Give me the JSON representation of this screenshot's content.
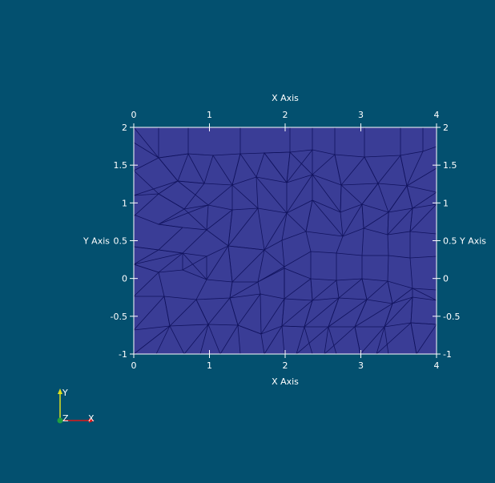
{
  "colors": {
    "background": "#03506f",
    "mesh_fill": "#3a3d96",
    "mesh_edge": "#11135e",
    "axis": "#ffffff",
    "text": "#ffffff",
    "triad_x": "#e01818",
    "triad_y": "#e0e020",
    "triad_z": "#20a040"
  },
  "axes": {
    "x_title_top": "X Axis",
    "x_title_bottom": "X Axis",
    "y_title_left": "Y Axis",
    "y_title_right": "Y Axis",
    "x_ticks": [
      "0",
      "1",
      "2",
      "3",
      "4"
    ],
    "y_ticks": [
      "2",
      "1.5",
      "1",
      "0.5",
      "0",
      "-0.5",
      "-1"
    ],
    "x_range": [
      0,
      4
    ],
    "y_range": [
      -1,
      2
    ]
  },
  "triad": {
    "x_label": "X",
    "y_label": "Y",
    "z_label": "Z"
  }
}
